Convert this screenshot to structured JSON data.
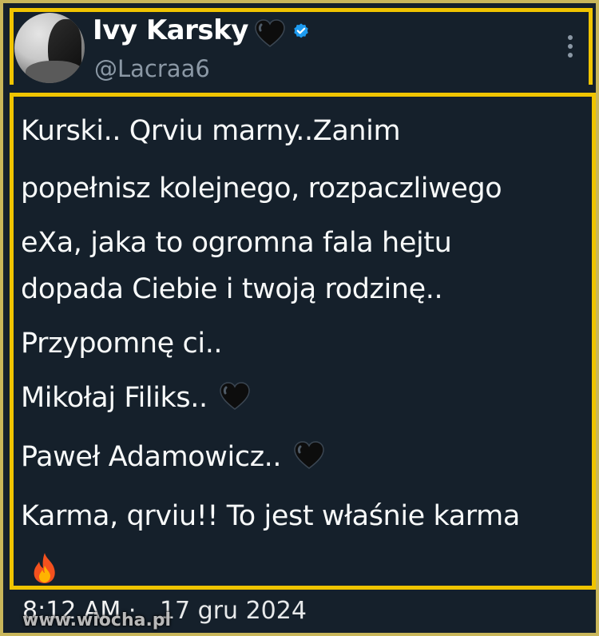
{
  "author": {
    "name": "Ivy Karsky",
    "handle": "@Lacraa6",
    "verified": true,
    "badge_icon": "black-heart-icon"
  },
  "post": {
    "lines": [
      {
        "text": "Kurski.. Qrviu marny..Zanim",
        "icon": null
      },
      {
        "text": "popełnisz kolejnego, rozpaczliwego",
        "icon": null
      },
      {
        "text": "eXa, jaka to ogromna fala hejtu",
        "icon": null
      },
      {
        "text": "dopada Ciebie i twoją rodzinę..",
        "icon": null
      },
      {
        "text": "Przypomnę ci..",
        "icon": null
      },
      {
        "text": "Mikołaj Filiks..",
        "icon": "black-heart-icon"
      },
      {
        "text": "Paweł Adamowicz..",
        "icon": "black-heart-icon"
      },
      {
        "text": "Karma, qrviu!! To jest właśnie karma",
        "icon": null
      }
    ],
    "trailing_emoji": "fire-icon"
  },
  "meta": {
    "time": "8:12 AM",
    "separator": "·",
    "date": "17 gru 2024"
  },
  "watermark": "www.wiocha.pl",
  "colors": {
    "background": "#15202b",
    "frame": "#f0c400",
    "text": "#f7f9f9",
    "secondary_text": "#8b98a5",
    "verified": "#1d9bf0"
  }
}
